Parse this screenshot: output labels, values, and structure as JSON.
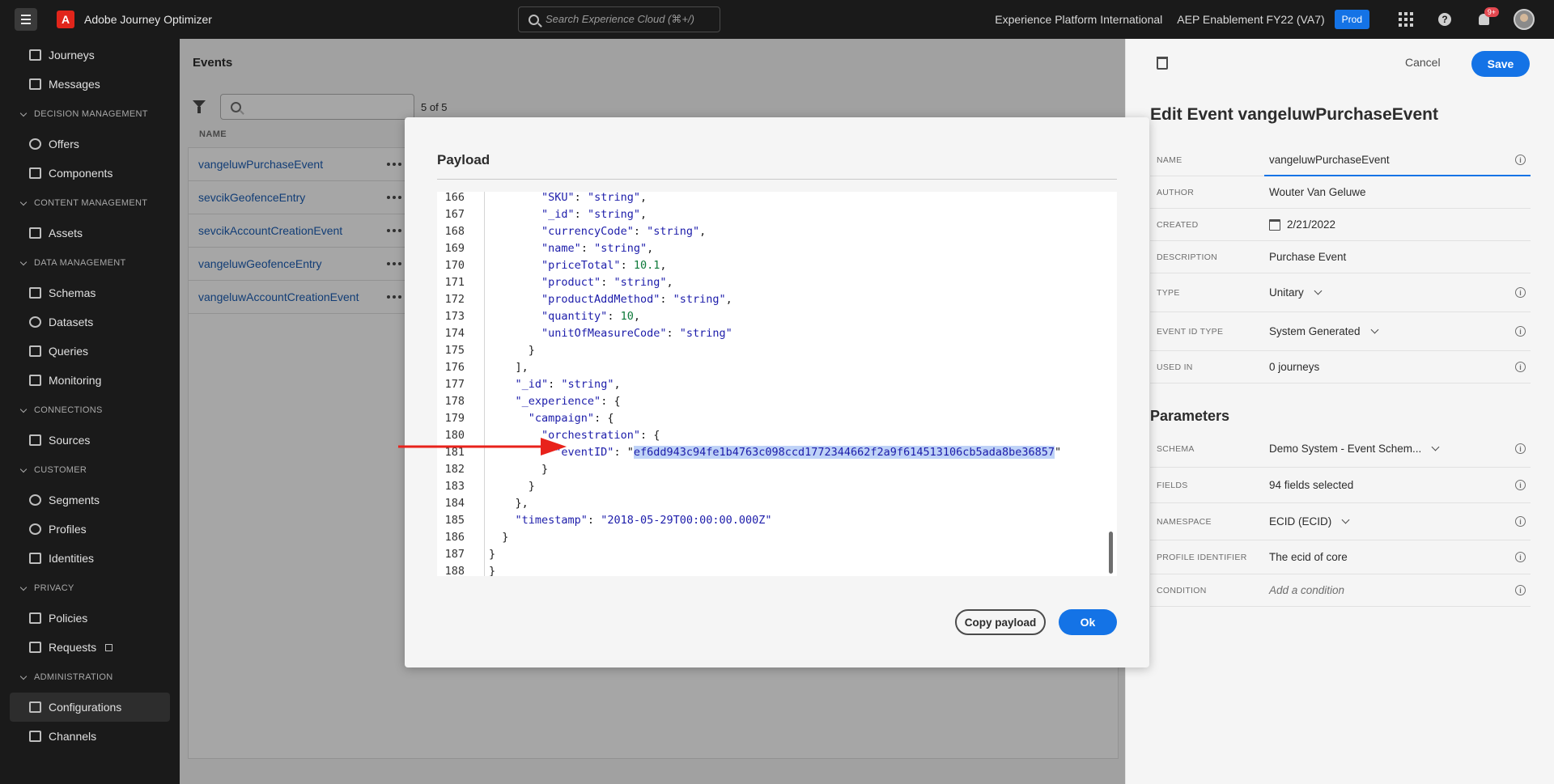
{
  "app": {
    "title": "Adobe Journey Optimizer",
    "search_placeholder": "Search Experience Cloud (⌘+/)",
    "org": "Experience Platform International",
    "sandbox": "AEP Enablement FY22 (VA7)",
    "env_badge": "Prod",
    "notifications_badge": "9+",
    "brand_color": "#1473e6"
  },
  "sidebar": {
    "top_items": [
      {
        "label": "Journeys",
        "icon": "journeys-icon"
      },
      {
        "label": "Messages",
        "icon": "messages-icon"
      }
    ],
    "sections": [
      {
        "title": "DECISION MANAGEMENT",
        "items": [
          "Offers",
          "Components"
        ]
      },
      {
        "title": "CONTENT MANAGEMENT",
        "items": [
          "Assets"
        ]
      },
      {
        "title": "DATA MANAGEMENT",
        "items": [
          "Schemas",
          "Datasets",
          "Queries",
          "Monitoring"
        ]
      },
      {
        "title": "CONNECTIONS",
        "items": [
          "Sources"
        ]
      },
      {
        "title": "CUSTOMER",
        "items": [
          "Segments",
          "Profiles",
          "Identities"
        ]
      },
      {
        "title": "PRIVACY",
        "items": [
          "Policies",
          "Requests"
        ]
      },
      {
        "title": "ADMINISTRATION",
        "items": [
          "Configurations",
          "Channels"
        ]
      }
    ]
  },
  "events": {
    "title": "Events",
    "count": "5 of 5",
    "column_name": "NAME",
    "rows": [
      "vangeluwPurchaseEvent",
      "sevcikGeofenceEntry",
      "sevcikAccountCreationEvent",
      "vangeluwGeofenceEntry",
      "vangeluwAccountCreationEvent"
    ]
  },
  "edit_panel": {
    "cancel_label": "Cancel",
    "save_label": "Save",
    "title": "Edit Event vangeluwPurchaseEvent",
    "fields": {
      "name_label": "NAME",
      "name_value": "vangeluwPurchaseEvent",
      "author_label": "AUTHOR",
      "author_value": "Wouter Van Geluwe",
      "created_label": "CREATED",
      "created_value": "2/21/2022",
      "description_label": "DESCRIPTION",
      "description_value": "Purchase Event",
      "type_label": "TYPE",
      "type_value": "Unitary",
      "eventid_label": "EVENT ID TYPE",
      "eventid_value": "System Generated",
      "usedin_label": "USED IN",
      "usedin_value": "0 journeys"
    },
    "parameters_title": "Parameters",
    "params": {
      "schema_label": "SCHEMA",
      "schema_value": "Demo System - Event Schem...",
      "fields_label": "FIELDS",
      "fields_value": "94 fields selected",
      "namespace_label": "NAMESPACE",
      "namespace_value": "ECID (ECID)",
      "profile_label": "PROFILE IDENTIFIER",
      "profile_value": "The ecid of core",
      "condition_label": "CONDITION",
      "condition_placeholder": "Add a condition"
    }
  },
  "modal": {
    "title": "Payload",
    "copy_label": "Copy payload",
    "ok_label": "Ok",
    "code_lines": [
      {
        "ln": "166",
        "text": "        \"SKU\": \"string\","
      },
      {
        "ln": "167",
        "text": "        \"_id\": \"string\","
      },
      {
        "ln": "168",
        "text": "        \"currencyCode\": \"string\","
      },
      {
        "ln": "169",
        "text": "        \"name\": \"string\","
      },
      {
        "ln": "170",
        "text": "        \"priceTotal\": 10.1,"
      },
      {
        "ln": "171",
        "text": "        \"product\": \"string\","
      },
      {
        "ln": "172",
        "text": "        \"productAddMethod\": \"string\","
      },
      {
        "ln": "173",
        "text": "        \"quantity\": 10,"
      },
      {
        "ln": "174",
        "text": "        \"unitOfMeasureCode\": \"string\""
      },
      {
        "ln": "175",
        "text": "      }"
      },
      {
        "ln": "176",
        "text": "    ],"
      },
      {
        "ln": "177",
        "text": "    \"_id\": \"string\","
      },
      {
        "ln": "178",
        "text": "    \"_experience\": {"
      },
      {
        "ln": "179",
        "text": "      \"campaign\": {"
      },
      {
        "ln": "180",
        "text": "        \"orchestration\": {"
      },
      {
        "ln": "181",
        "text": "          \"eventID\": \"ef6dd943c94fe1b4763c098ccd1772344662f2a9f614513106cb5ada8be36857\""
      },
      {
        "ln": "182",
        "text": "        }"
      },
      {
        "ln": "183",
        "text": "      }"
      },
      {
        "ln": "184",
        "text": "    },"
      },
      {
        "ln": "185",
        "text": "    \"timestamp\": \"2018-05-29T00:00:00.000Z\""
      },
      {
        "ln": "186",
        "text": "  }"
      },
      {
        "ln": "187",
        "text": "}"
      },
      {
        "ln": "188",
        "text": "}"
      }
    ],
    "selected_value": "ef6dd943c94fe1b4763c098ccd1772344662f2a9f614513106cb5ada8be36857"
  }
}
